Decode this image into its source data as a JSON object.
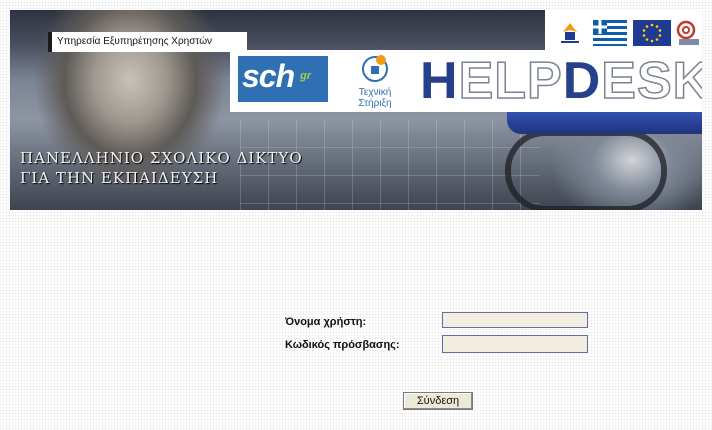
{
  "banner": {
    "service_label": "Υπηρεσία Εξυπηρέτησης Χρηστών",
    "subtitle_line1": "ΠΑΝΕΛΛΗΝΙΟ ΣΧΟΛΙΚΟ ΔΙΚΤΥΟ",
    "subtitle_line2": "ΓΙΑ ΤΗΝ ΕΚΠΑΙΔΕΥΣΗ",
    "sch_logo": "sch",
    "sch_logo_suffix": "gr",
    "tech_support_line1": "Τεχνική",
    "tech_support_line2": "Στήριξη",
    "helpdesk_parts": {
      "h": "H",
      "elp": "ELP",
      "d": "D",
      "esk": "ESK"
    },
    "icons": [
      "ministry-logo-icon",
      "greek-flag-icon",
      "eu-flag-icon",
      "at-sign-logo-icon"
    ]
  },
  "login": {
    "username_label": "Όνομα χρήστη:",
    "password_label": "Κωδικός πρόσβασης:",
    "username_value": "",
    "password_value": "",
    "submit_label": "Σύνδεση"
  },
  "colors": {
    "brand_blue": "#27408b",
    "sch_blue": "#2f6fb3",
    "input_background": "#f1ede1"
  }
}
